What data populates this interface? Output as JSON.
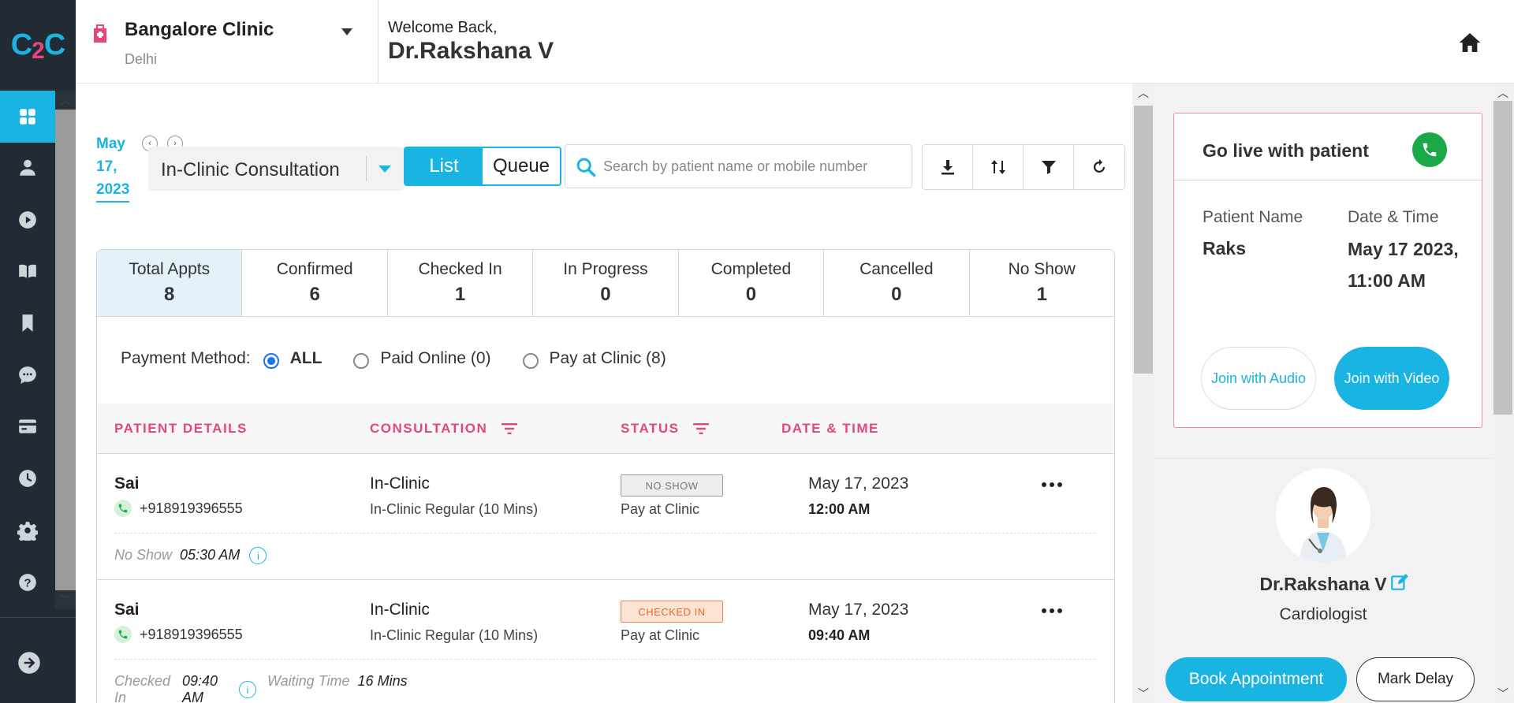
{
  "logo": {
    "c1": "C",
    "two": "2",
    "c2": "C"
  },
  "nav": {
    "items": [
      "dashboard-icon",
      "person-icon",
      "play-icon",
      "book-icon",
      "bookmark-icon",
      "chat-icon",
      "card-icon",
      "clock-icon",
      "gear-icon",
      "help-icon"
    ],
    "active": "dashboard-icon",
    "logout": "logout-icon"
  },
  "header": {
    "clinic_name": "Bangalore Clinic",
    "clinic_city": "Delhi",
    "welcome": "Welcome Back,",
    "doctor": "Dr.Rakshana V"
  },
  "toolbar": {
    "date_month": "May",
    "date_day": "17,",
    "date_year": "2023",
    "consultation_type": "In-Clinic Consultation",
    "view_list": "List",
    "view_queue": "Queue",
    "active_view": "List",
    "search_placeholder": "Search by patient name or mobile number",
    "tools": [
      "download-icon",
      "sort-icon",
      "filter-icon",
      "refresh-icon"
    ]
  },
  "stats": [
    {
      "label": "Total Appts",
      "value": "8",
      "active": true
    },
    {
      "label": "Confirmed",
      "value": "6"
    },
    {
      "label": "Checked In",
      "value": "1"
    },
    {
      "label": "In Progress",
      "value": "0"
    },
    {
      "label": "Completed",
      "value": "0"
    },
    {
      "label": "Cancelled",
      "value": "0"
    },
    {
      "label": "No Show",
      "value": "1"
    }
  ],
  "payment": {
    "label": "Payment Method:",
    "options": [
      "ALL",
      "Paid Online (0)",
      "Pay at Clinic (8)"
    ],
    "selected": "ALL"
  },
  "table": {
    "headers": [
      "PATIENT DETAILS",
      "CONSULTATION",
      "STATUS",
      "DATE & TIME"
    ],
    "rows": [
      {
        "name": "Sai",
        "phone": "+918919396555",
        "consult": "In-Clinic",
        "consult_sub": "In-Clinic Regular (10 Mins)",
        "status": "NO SHOW",
        "payment": "Pay at Clinic",
        "date": "May 17, 2023",
        "time": "12:00 AM",
        "foot_label": "No Show",
        "foot_value": "05:30 AM"
      },
      {
        "name": "Sai",
        "phone": "+918919396555",
        "consult": "In-Clinic",
        "consult_sub": "In-Clinic Regular (10 Mins)",
        "status": "CHECKED IN",
        "payment": "Pay at Clinic",
        "date": "May 17, 2023",
        "time": "09:40 AM",
        "foot_label": "Checked In",
        "foot_value": "09:40 AM",
        "wait_label": "Waiting Time",
        "wait_value": "16 Mins"
      }
    ]
  },
  "live": {
    "title": "Go live with patient",
    "patient_label": "Patient Name",
    "patient_value": "Raks",
    "dt_label": "Date & Time",
    "dt_value": "May 17 2023, 11:00 AM",
    "audio_btn": "Join with Audio",
    "video_btn": "Join with Video"
  },
  "profile": {
    "name": "Dr.Rakshana V",
    "specialty": "Cardiologist",
    "book_btn": "Book Appointment",
    "delay_btn": "Mark Delay"
  },
  "colors": {
    "accent": "#1ab4e3",
    "pink": "#e6467f",
    "nav_bg": "#222b33",
    "green": "#1ba849"
  }
}
